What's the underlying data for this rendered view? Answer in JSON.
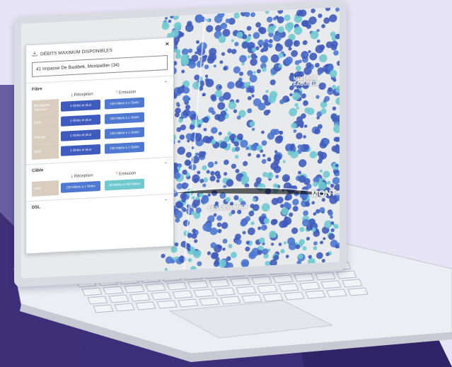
{
  "panel": {
    "title": "DÉBITS MAXIMUM DISPONIBLES",
    "close": "×",
    "address": "41 Impasse De Baalbek, Montpellier (34)"
  },
  "sections": [
    {
      "name": "Fibre",
      "col_reception": "Réception",
      "col_emission": "Emission",
      "rows": [
        {
          "operator": "Bouygues Telecom",
          "reception": "1 Gbit/s et plus",
          "emission": "100 Mbit/s à 1 Gbit/s"
        },
        {
          "operator": "Free",
          "reception": "1 Gbit/s et plus",
          "emission": "100 Mbit/s à 1 Gbit/s"
        },
        {
          "operator": "Orange",
          "reception": "1 Gbit/s et plus",
          "emission": "100 Mbit/s à 1 Gbit/s"
        },
        {
          "operator": "SFR",
          "reception": "1 Gbit/s et plus",
          "emission": "100 Mbit/s à 1 Gbit/s"
        }
      ]
    },
    {
      "name": "Câble",
      "col_reception": "Réception",
      "col_emission": "Emission",
      "rows": [
        {
          "operator": "SFR",
          "reception": "100 Mbit/s à 1 Gbit/s",
          "emission": "30 Mbit/s à 100 Mbit/s"
        }
      ]
    }
  ],
  "dsl": "DSL",
  "map": {
    "labels": [
      "MOITAUX FACULTÉS",
      "MONT",
      "LES CÉVENNES"
    ]
  },
  "colors": {
    "background": "#e7e5f5",
    "coverage_dark": "#3f5bbd",
    "coverage_mid": "#4e78d1",
    "coverage_light": "#6fcad0",
    "operator_bg": "#d8cdbf",
    "dark_purple": "#2f2466"
  },
  "icons": {
    "header": "download-icon",
    "reception": "download-icon",
    "emission": "upload-icon"
  }
}
